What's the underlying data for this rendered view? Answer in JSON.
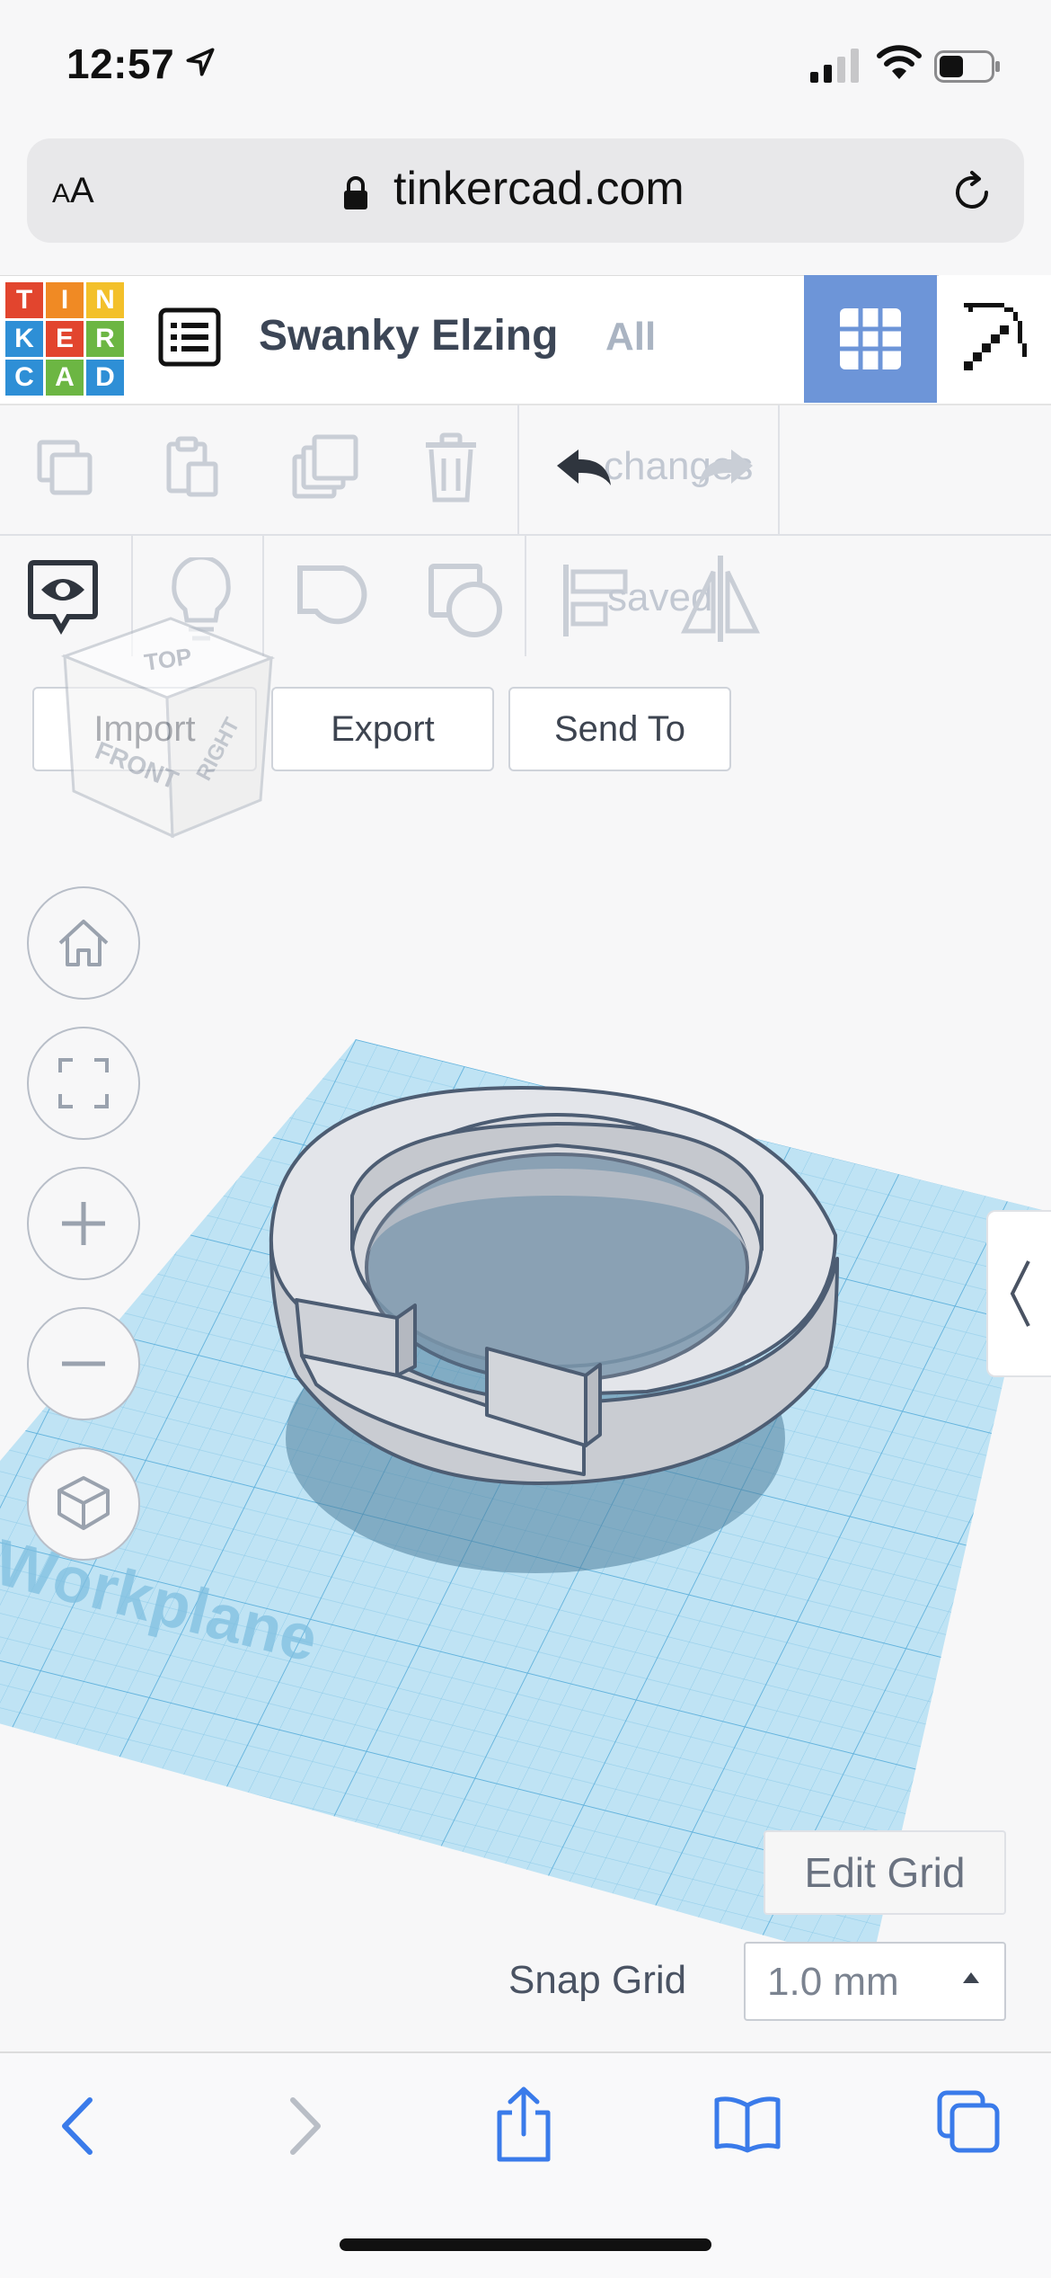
{
  "status": {
    "time": "12:57"
  },
  "browser": {
    "aa_small": "A",
    "aa_large": "A",
    "url": "tinkercad.com"
  },
  "header": {
    "logo_letters": [
      "T",
      "I",
      "N",
      "K",
      "E",
      "R",
      "C",
      "A",
      "D"
    ],
    "logo_colors": [
      "#e2452e",
      "#f08a24",
      "#f3c02a",
      "#2e8fd6",
      "#e2452e",
      "#6cb643",
      "#2e8fd6",
      "#6cb643",
      "#2e8fd6"
    ],
    "design_name": "Swanky Elzing",
    "all_link": "All",
    "accent": "#6d95d8"
  },
  "toolbar": {
    "changes_label": "changes",
    "saved_label": "saved",
    "import_label": "Import",
    "export_label": "Export",
    "send_to_label": "Send To"
  },
  "view_cube": {
    "top": "TOP",
    "front": "FRONT",
    "right": "RIGHT"
  },
  "workplane": {
    "label": "Workplane",
    "color": "#8fcbea"
  },
  "grid": {
    "edit_label": "Edit Grid",
    "snap_label": "Snap Grid",
    "snap_value": "1.0 mm"
  },
  "safari_bar": {
    "icons": [
      "back-icon",
      "forward-icon",
      "share-icon",
      "bookmarks-icon",
      "tabs-icon"
    ]
  }
}
